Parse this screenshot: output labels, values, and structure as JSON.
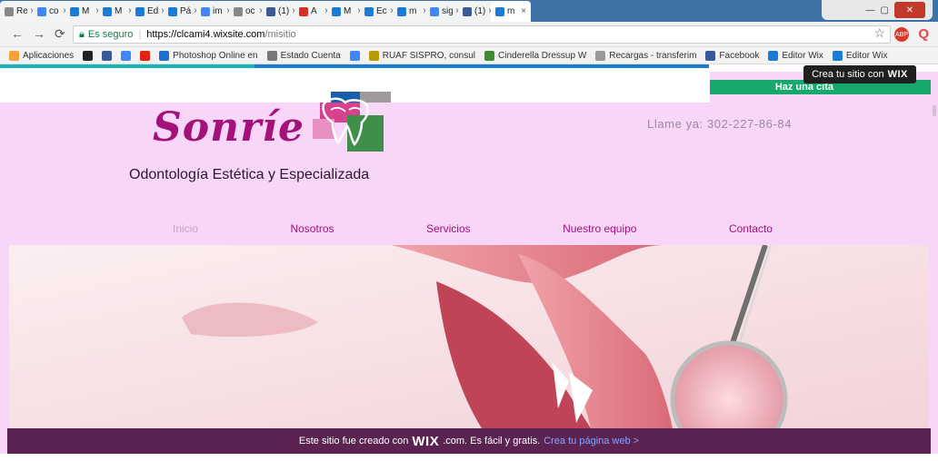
{
  "browser": {
    "tabs": [
      {
        "label": "Re",
        "icon": "doc-icon",
        "color": "#888888"
      },
      {
        "label": "co",
        "icon": "google-icon",
        "color": "#4285f4"
      },
      {
        "label": "M",
        "icon": "wix-icon",
        "color": "#1d7bd6"
      },
      {
        "label": "M",
        "icon": "wix-icon",
        "color": "#1d7bd6"
      },
      {
        "label": "Ed",
        "icon": "wix-icon",
        "color": "#1d7bd6"
      },
      {
        "label": "Pá",
        "icon": "wix-icon",
        "color": "#1d7bd6"
      },
      {
        "label": "im",
        "icon": "google-icon",
        "color": "#4285f4"
      },
      {
        "label": "oc",
        "icon": "doc-icon",
        "color": "#888888"
      },
      {
        "label": "(1)",
        "icon": "facebook-icon",
        "color": "#3b5998"
      },
      {
        "label": "A",
        "icon": "gmail-icon",
        "color": "#d93025"
      },
      {
        "label": "M",
        "icon": "wix-icon",
        "color": "#1d7bd6"
      },
      {
        "label": "Ec",
        "icon": "wix-icon",
        "color": "#1d7bd6"
      },
      {
        "label": "m",
        "icon": "wix-icon",
        "color": "#1d7bd6"
      },
      {
        "label": "sig",
        "icon": "google-icon",
        "color": "#4285f4"
      },
      {
        "label": "(1)",
        "icon": "facebook-icon",
        "color": "#3b5998"
      },
      {
        "label": "m",
        "icon": "wix-icon",
        "color": "#1d7bd6",
        "active": true
      }
    ],
    "address": {
      "secure_label": "Es seguro",
      "url_host": "https://clcami4.wixsite.com",
      "url_path": "/misitio"
    },
    "bookmarks": [
      {
        "label": "Aplicaciones",
        "icon": "apps-icon",
        "color": "#f2a23a"
      },
      {
        "label": "",
        "icon": "bw-icon",
        "color": "#222222"
      },
      {
        "label": "",
        "icon": "facebook-icon",
        "color": "#3b5998"
      },
      {
        "label": "",
        "icon": "google-icon",
        "color": "#4285f4"
      },
      {
        "label": "",
        "icon": "youtube-icon",
        "color": "#e62117"
      },
      {
        "label": "Photoshop Online en",
        "icon": "photoshop-icon",
        "color": "#1f6fd1"
      },
      {
        "label": "Estado Cuenta",
        "icon": "doc-icon",
        "color": "#777777"
      },
      {
        "label": "",
        "icon": "google-icon",
        "color": "#4285f4"
      },
      {
        "label": "RUAF SISPRO, consul",
        "icon": "ruaf-icon",
        "color": "#b99a00"
      },
      {
        "label": "Cinderella Dressup W",
        "icon": "game-icon",
        "color": "#3f8c2f"
      },
      {
        "label": "Recargas - transferim",
        "icon": "doc-icon",
        "color": "#999999"
      },
      {
        "label": "Facebook",
        "icon": "facebook-icon",
        "color": "#3b5998"
      },
      {
        "label": "Editor Wix",
        "icon": "wix-icon",
        "color": "#1d7bd6"
      },
      {
        "label": "Editor Wix",
        "icon": "wix-icon",
        "color": "#1d7bd6"
      }
    ]
  },
  "wix_tooltip": {
    "text": "Crea tu sitio con",
    "brand": "WIX"
  },
  "cta": {
    "label": "Haz una cita"
  },
  "site": {
    "logo_text": "Sonríe",
    "phone": "Llame ya: 302-227-86-84",
    "tagline": "Odontología Estética y Especializada",
    "menu": [
      {
        "label": "Inicio",
        "active": true
      },
      {
        "label": "Nosotros"
      },
      {
        "label": "Servicios"
      },
      {
        "label": "Nuestro equipo"
      },
      {
        "label": "Contacto"
      }
    ]
  },
  "banner": {
    "prefix": "Este sitio fue creado con",
    "brand": "WIX",
    "suffix": ".com. Es fácil y gratis.",
    "link": "Crea tu página web >"
  },
  "colors": {
    "brand_magenta": "#a2127a",
    "background_pink": "#f7d6f7",
    "banner": "#5a2352",
    "cta_green": "#17a86b"
  }
}
